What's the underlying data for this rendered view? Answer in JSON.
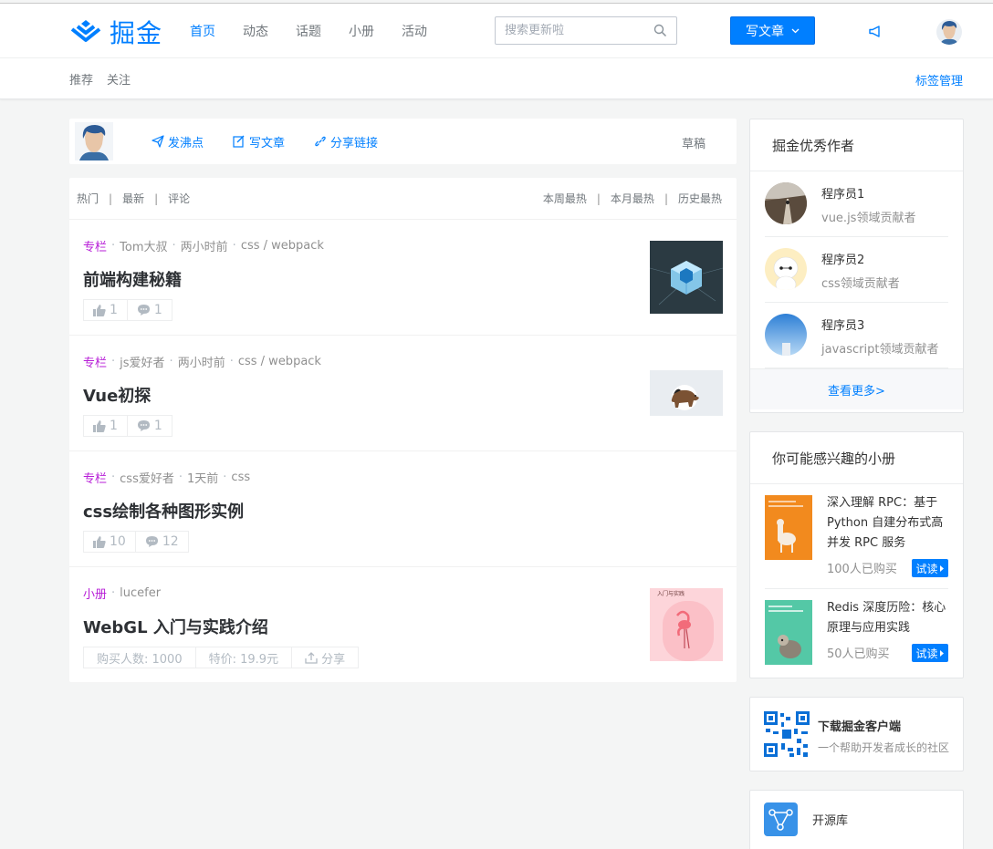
{
  "header": {
    "logo_text": "掘金",
    "nav": [
      {
        "label": "首页",
        "active": true
      },
      {
        "label": "动态",
        "active": false
      },
      {
        "label": "话题",
        "active": false
      },
      {
        "label": "小册",
        "active": false
      },
      {
        "label": "活动",
        "active": false
      }
    ],
    "search_placeholder": "搜索更新啦",
    "write_button": "写文章",
    "brand_color": "#007fff"
  },
  "subnav": {
    "items": [
      "推荐",
      "关注"
    ],
    "tag_manage": "标签管理"
  },
  "composer": {
    "actions": [
      "发沸点",
      "写文章",
      "分享链接"
    ],
    "draft": "草稿"
  },
  "feed": {
    "tabs_left": [
      "热门",
      "最新",
      "评论"
    ],
    "tabs_right": [
      "本周最热",
      "本月最热",
      "历史最热"
    ],
    "articles": [
      {
        "category": "专栏",
        "author": "Tom大叔",
        "time": "两小时前",
        "tags": "css / webpack",
        "title": "前端构建秘籍",
        "likes": "1",
        "comments": "1"
      },
      {
        "category": "专栏",
        "author": "js爱好者",
        "time": "两小时前",
        "tags": "css / webpack",
        "title": "Vue初探",
        "likes": "1",
        "comments": "1"
      },
      {
        "category": "专栏",
        "author": "css爱好者",
        "time": "1天前",
        "tags": "css",
        "title": "css绘制各种图形实例",
        "likes": "10",
        "comments": "12"
      },
      {
        "category": "小册",
        "author": "lucefer",
        "title": "WebGL 入门与实践介绍",
        "buyers": "购买人数: 1000",
        "price": "特价: 19.9元",
        "share": "分享",
        "cover_text": "入门与实践"
      }
    ]
  },
  "sidebar": {
    "authors_title": "掘金优秀作者",
    "authors": [
      {
        "name": "程序员1",
        "desc": "vue.js领域贡献者"
      },
      {
        "name": "程序员2",
        "desc": "css领域贡献者"
      },
      {
        "name": "程序员3",
        "desc": "javascript领域贡献者"
      }
    ],
    "see_more": "查看更多>",
    "books_title": "你可能感兴趣的小册",
    "books": [
      {
        "title": "深入理解 RPC：基于 Python 自建分布式高并发 RPC 服务",
        "buyers": "100人已购买",
        "try": "试读"
      },
      {
        "title": "Redis 深度历险：核心原理与应用实践",
        "buyers": "50人已购买",
        "try": "试读"
      }
    ],
    "download_title": "下载掘金客户端",
    "download_desc": "一个帮助开发者成长的社区",
    "opensource_label": "开源库"
  }
}
